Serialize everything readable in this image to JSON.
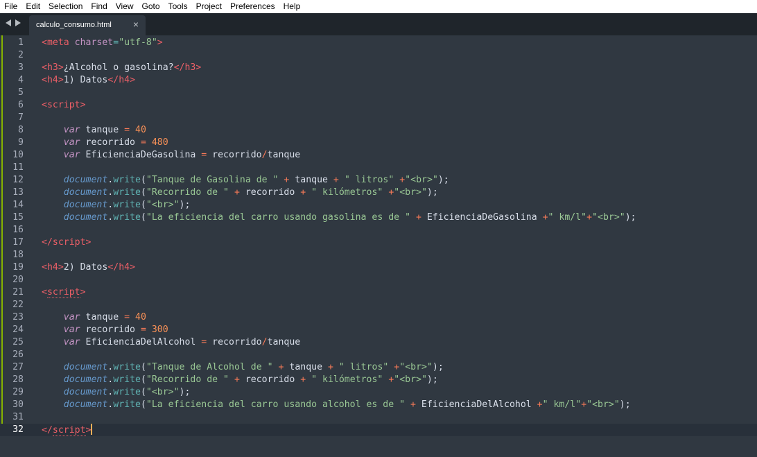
{
  "menu": [
    "File",
    "Edit",
    "Selection",
    "Find",
    "View",
    "Goto",
    "Tools",
    "Project",
    "Preferences",
    "Help"
  ],
  "tab": {
    "label": "calculo_consumo.html",
    "close": "×"
  },
  "lines": [
    [
      [
        "<",
        "tag"
      ],
      [
        "meta",
        "tag"
      ],
      [
        " ",
        "plain"
      ],
      [
        "charset",
        "attr"
      ],
      [
        "=",
        "punct"
      ],
      [
        "\"utf-8\"",
        "str"
      ],
      [
        ">",
        "tag"
      ]
    ],
    [],
    [
      [
        "<",
        "tag"
      ],
      [
        "h3",
        "tag"
      ],
      [
        ">",
        "tag"
      ],
      [
        "¿Alcohol o gasolina?",
        "plain"
      ],
      [
        "</",
        "tag"
      ],
      [
        "h3",
        "tag"
      ],
      [
        ">",
        "tag"
      ]
    ],
    [
      [
        "<",
        "tag"
      ],
      [
        "h4",
        "tag"
      ],
      [
        ">",
        "tag"
      ],
      [
        "1) Datos",
        "plain"
      ],
      [
        "</",
        "tag"
      ],
      [
        "h4",
        "tag"
      ],
      [
        ">",
        "tag"
      ]
    ],
    [],
    [
      [
        "<",
        "tag"
      ],
      [
        "script",
        "tag"
      ],
      [
        ">",
        "tag"
      ]
    ],
    [],
    [
      [
        "    ",
        "plain"
      ],
      [
        "var",
        "var"
      ],
      [
        " tanque ",
        "plain"
      ],
      [
        "=",
        "op"
      ],
      [
        " ",
        "plain"
      ],
      [
        "40",
        "num"
      ]
    ],
    [
      [
        "    ",
        "plain"
      ],
      [
        "var",
        "var"
      ],
      [
        " recorrido ",
        "plain"
      ],
      [
        "=",
        "op"
      ],
      [
        " ",
        "plain"
      ],
      [
        "480",
        "num"
      ]
    ],
    [
      [
        "    ",
        "plain"
      ],
      [
        "var",
        "var"
      ],
      [
        " EficienciaDeGasolina ",
        "plain"
      ],
      [
        "=",
        "op"
      ],
      [
        " recorrido",
        "plain"
      ],
      [
        "/",
        "op"
      ],
      [
        "tanque",
        "plain"
      ]
    ],
    [],
    [
      [
        "    ",
        "plain"
      ],
      [
        "document",
        "obj"
      ],
      [
        ".",
        "plain"
      ],
      [
        "write",
        "method"
      ],
      [
        "(",
        "plain"
      ],
      [
        "\"Tanque de Gasolina de \"",
        "str"
      ],
      [
        " ",
        "plain"
      ],
      [
        "+",
        "op"
      ],
      [
        " tanque ",
        "plain"
      ],
      [
        "+",
        "op"
      ],
      [
        " ",
        "plain"
      ],
      [
        "\" litros\"",
        "str"
      ],
      [
        " ",
        "plain"
      ],
      [
        "+",
        "op"
      ],
      [
        "\"<br>\"",
        "str"
      ],
      [
        ");",
        "plain"
      ]
    ],
    [
      [
        "    ",
        "plain"
      ],
      [
        "document",
        "obj"
      ],
      [
        ".",
        "plain"
      ],
      [
        "write",
        "method"
      ],
      [
        "(",
        "plain"
      ],
      [
        "\"Recorrido de \"",
        "str"
      ],
      [
        " ",
        "plain"
      ],
      [
        "+",
        "op"
      ],
      [
        " recorrido ",
        "plain"
      ],
      [
        "+",
        "op"
      ],
      [
        " ",
        "plain"
      ],
      [
        "\" kilómetros\"",
        "str"
      ],
      [
        " ",
        "plain"
      ],
      [
        "+",
        "op"
      ],
      [
        "\"<br>\"",
        "str"
      ],
      [
        ");",
        "plain"
      ]
    ],
    [
      [
        "    ",
        "plain"
      ],
      [
        "document",
        "obj"
      ],
      [
        ".",
        "plain"
      ],
      [
        "write",
        "method"
      ],
      [
        "(",
        "plain"
      ],
      [
        "\"<br>\"",
        "str"
      ],
      [
        ");",
        "plain"
      ]
    ],
    [
      [
        "    ",
        "plain"
      ],
      [
        "document",
        "obj"
      ],
      [
        ".",
        "plain"
      ],
      [
        "write",
        "method"
      ],
      [
        "(",
        "plain"
      ],
      [
        "\"La eficiencia del carro usando gasolina es de \"",
        "str"
      ],
      [
        " ",
        "plain"
      ],
      [
        "+",
        "op"
      ],
      [
        " EficienciaDeGasolina ",
        "plain"
      ],
      [
        "+",
        "op"
      ],
      [
        "\" km/l\"",
        "str"
      ],
      [
        "+",
        "op"
      ],
      [
        "\"<br>\"",
        "str"
      ],
      [
        ");",
        "plain"
      ]
    ],
    [],
    [
      [
        "</",
        "tag"
      ],
      [
        "script",
        "tag"
      ],
      [
        ">",
        "tag"
      ]
    ],
    [],
    [
      [
        "<",
        "tag"
      ],
      [
        "h4",
        "tag"
      ],
      [
        ">",
        "tag"
      ],
      [
        "2) Datos",
        "plain"
      ],
      [
        "</",
        "tag"
      ],
      [
        "h4",
        "tag"
      ],
      [
        ">",
        "tag"
      ]
    ],
    [],
    [
      [
        "<",
        "tag"
      ],
      [
        "script",
        "tag"
      ],
      [
        ">",
        "tag"
      ]
    ],
    [],
    [
      [
        "    ",
        "plain"
      ],
      [
        "var",
        "var"
      ],
      [
        " tanque ",
        "plain"
      ],
      [
        "=",
        "op"
      ],
      [
        " ",
        "plain"
      ],
      [
        "40",
        "num"
      ]
    ],
    [
      [
        "    ",
        "plain"
      ],
      [
        "var",
        "var"
      ],
      [
        " recorrido ",
        "plain"
      ],
      [
        "=",
        "op"
      ],
      [
        " ",
        "plain"
      ],
      [
        "300",
        "num"
      ]
    ],
    [
      [
        "    ",
        "plain"
      ],
      [
        "var",
        "var"
      ],
      [
        " EficienciaDelAlcohol ",
        "plain"
      ],
      [
        "=",
        "op"
      ],
      [
        " recorrido",
        "plain"
      ],
      [
        "/",
        "op"
      ],
      [
        "tanque",
        "plain"
      ]
    ],
    [],
    [
      [
        "    ",
        "plain"
      ],
      [
        "document",
        "obj"
      ],
      [
        ".",
        "plain"
      ],
      [
        "write",
        "method"
      ],
      [
        "(",
        "plain"
      ],
      [
        "\"Tanque de Alcohol de \"",
        "str"
      ],
      [
        " ",
        "plain"
      ],
      [
        "+",
        "op"
      ],
      [
        " tanque ",
        "plain"
      ],
      [
        "+",
        "op"
      ],
      [
        " ",
        "plain"
      ],
      [
        "\" litros\"",
        "str"
      ],
      [
        " ",
        "plain"
      ],
      [
        "+",
        "op"
      ],
      [
        "\"<br>\"",
        "str"
      ],
      [
        ");",
        "plain"
      ]
    ],
    [
      [
        "    ",
        "plain"
      ],
      [
        "document",
        "obj"
      ],
      [
        ".",
        "plain"
      ],
      [
        "write",
        "method"
      ],
      [
        "(",
        "plain"
      ],
      [
        "\"Recorrido de \"",
        "str"
      ],
      [
        " ",
        "plain"
      ],
      [
        "+",
        "op"
      ],
      [
        " recorrido ",
        "plain"
      ],
      [
        "+",
        "op"
      ],
      [
        " ",
        "plain"
      ],
      [
        "\" kilómetros\"",
        "str"
      ],
      [
        " ",
        "plain"
      ],
      [
        "+",
        "op"
      ],
      [
        "\"<br>\"",
        "str"
      ],
      [
        ");",
        "plain"
      ]
    ],
    [
      [
        "    ",
        "plain"
      ],
      [
        "document",
        "obj"
      ],
      [
        ".",
        "plain"
      ],
      [
        "write",
        "method"
      ],
      [
        "(",
        "plain"
      ],
      [
        "\"<br>\"",
        "str"
      ],
      [
        ");",
        "plain"
      ]
    ],
    [
      [
        "    ",
        "plain"
      ],
      [
        "document",
        "obj"
      ],
      [
        ".",
        "plain"
      ],
      [
        "write",
        "method"
      ],
      [
        "(",
        "plain"
      ],
      [
        "\"La eficiencia del carro usando alcohol es de \"",
        "str"
      ],
      [
        " ",
        "plain"
      ],
      [
        "+",
        "op"
      ],
      [
        " EficienciaDelAlcohol ",
        "plain"
      ],
      [
        "+",
        "op"
      ],
      [
        "\" km/l\"",
        "str"
      ],
      [
        "+",
        "op"
      ],
      [
        "\"<br>\"",
        "str"
      ],
      [
        ");",
        "plain"
      ]
    ],
    [],
    [
      [
        "</",
        "tag"
      ],
      [
        "script",
        "tag"
      ],
      [
        ">",
        "tag"
      ]
    ]
  ],
  "current_line": 32,
  "colors": {
    "background": "#303841",
    "tab_bar": "#1f252b",
    "gutter_modified": "#86b300",
    "cursor": "#f9ae58"
  }
}
